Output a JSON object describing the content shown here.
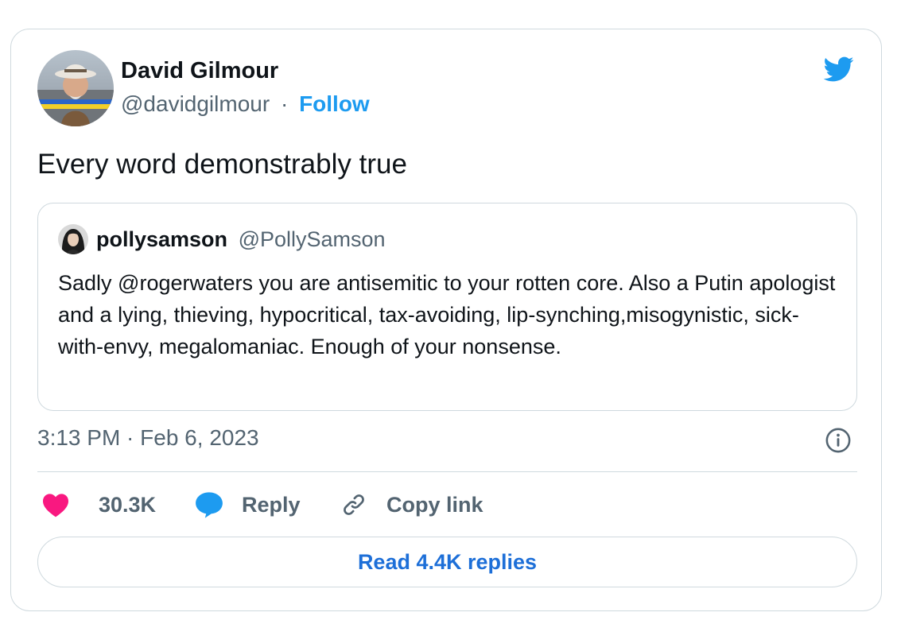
{
  "author": {
    "name": "David Gilmour",
    "handle": "@davidgilmour",
    "separator": "·",
    "follow_label": "Follow"
  },
  "tweet": {
    "text": "Every word demonstrably true",
    "timestamp": "3:13 PM · Feb 6, 2023"
  },
  "quoted_tweet": {
    "name": "pollysamson",
    "handle": "@PollySamson",
    "text": "Sadly @rogerwaters you are antisemitic to your rotten core. Also a Putin apologist and a lying, thieving, hypocritical, tax-avoiding, lip-synching,misogynistic, sick-with-envy, megalomaniac. Enough of your nonsense."
  },
  "actions": {
    "like_count": "30.3K",
    "reply_label": "Reply",
    "copy_label": "Copy link"
  },
  "read_replies_label": "Read 4.4K replies",
  "icons": {
    "brand": "twitter-bird-icon",
    "info": "info-icon",
    "like": "heart-icon",
    "reply": "speech-bubble-icon",
    "copy": "link-icon"
  },
  "colors": {
    "brand_blue": "#1d9bf0",
    "link_blue": "#1d6fd8",
    "heart": "#f91880",
    "text": "#0f1419",
    "muted": "#536471",
    "border": "#cfd9de"
  }
}
